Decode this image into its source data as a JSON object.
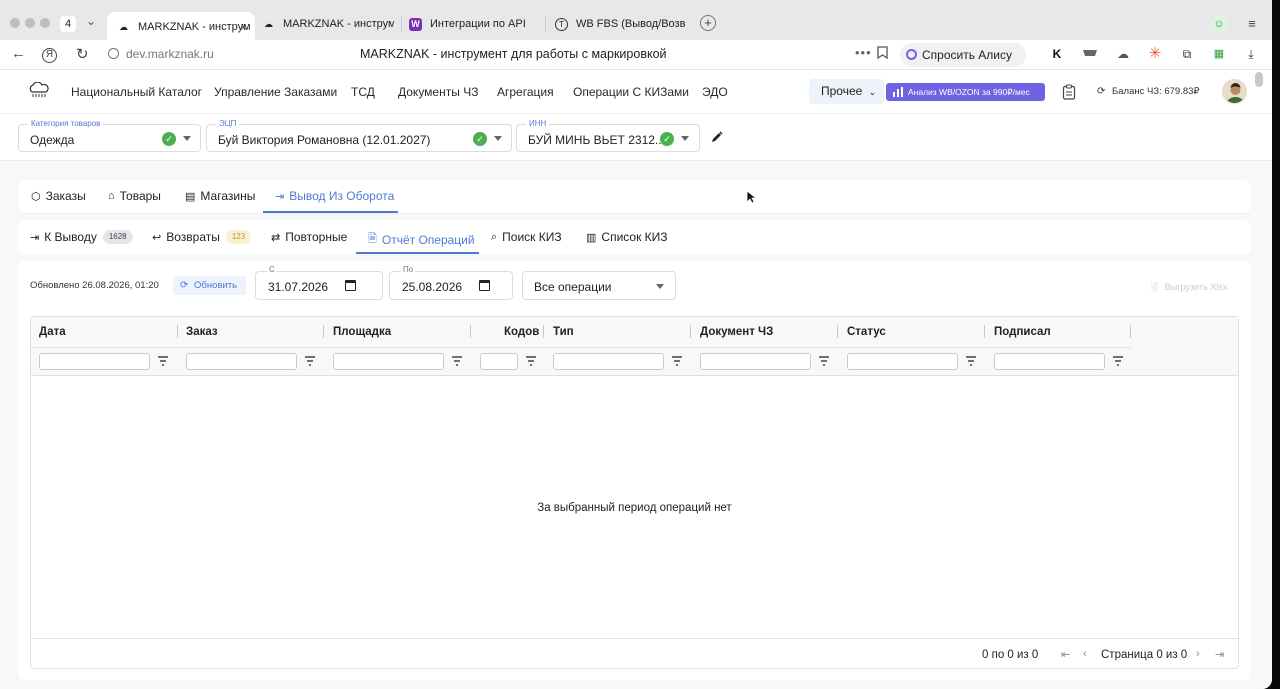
{
  "browser": {
    "tab_count": "4",
    "tabs": [
      {
        "title": "MARKZNAK - инструм",
        "close": "×"
      },
      {
        "title": "MARKZNAK - инструмент"
      },
      {
        "title": "Интеграции по API"
      },
      {
        "title": "WB FBS (Вывод/Возврат"
      }
    ],
    "new_tab": "+",
    "menu": "≡",
    "url_host": "dev.markznak.ru",
    "page_title": "MARKZNAK - инструмент для работы с маркировкой",
    "alice_label": "Спросить Алису AI"
  },
  "nav": {
    "items": [
      "Национальный Каталог",
      "Управление Заказами",
      "ТСД",
      "Документы ЧЗ",
      "Агрегация",
      "Операции С КИЗами",
      "ЭДО"
    ],
    "other_label": "Прочее",
    "promo_label": "Анализ WB/OZON за 990₽/мес",
    "balance_label": "Баланс ЧЗ: 679.83₽"
  },
  "selectors": {
    "category": {
      "label": "Категория товаров",
      "value": "Одежда"
    },
    "signature": {
      "label": "ЭЦП",
      "value": "Буй Виктория Романовна (12.01.2027)"
    },
    "inn": {
      "label": "ИНН",
      "value": "БУЙ МИНЬ ВЬЕТ 2312..."
    }
  },
  "main_tabs": [
    {
      "label": "Заказы"
    },
    {
      "label": "Товары"
    },
    {
      "label": "Магазины"
    },
    {
      "label": "Вывод Из Оборота"
    }
  ],
  "sub_tabs": [
    {
      "label": "К Выводу",
      "badge": "1628"
    },
    {
      "label": "Возвраты",
      "badge": "123"
    },
    {
      "label": "Повторные"
    },
    {
      "label": "Отчёт Операций"
    },
    {
      "label": "Поиск КИЗ"
    },
    {
      "label": "Список КИЗ"
    }
  ],
  "report": {
    "updated_text": "Обновлено 26.08.2026, 01:20",
    "refresh_label": "Обновить",
    "from_label": "С",
    "from_value": "31.07.2026",
    "to_label": "По",
    "to_value": "25.08.2026",
    "operations_value": "Все операции",
    "export_label": "Выгрузить Xlsx"
  },
  "table": {
    "columns": [
      "Дата",
      "Заказ",
      "Площадка",
      "Кодов",
      "Тип",
      "Документ ЧЗ",
      "Статус",
      "Подписал"
    ],
    "empty_message": "За выбранный период операций нет",
    "range_text": "0 по 0 из 0",
    "page_text": "Страница 0 из 0"
  },
  "colors": {
    "accent": "#4a7ad6",
    "promo": "#6e64e3",
    "success": "#4caf50"
  }
}
